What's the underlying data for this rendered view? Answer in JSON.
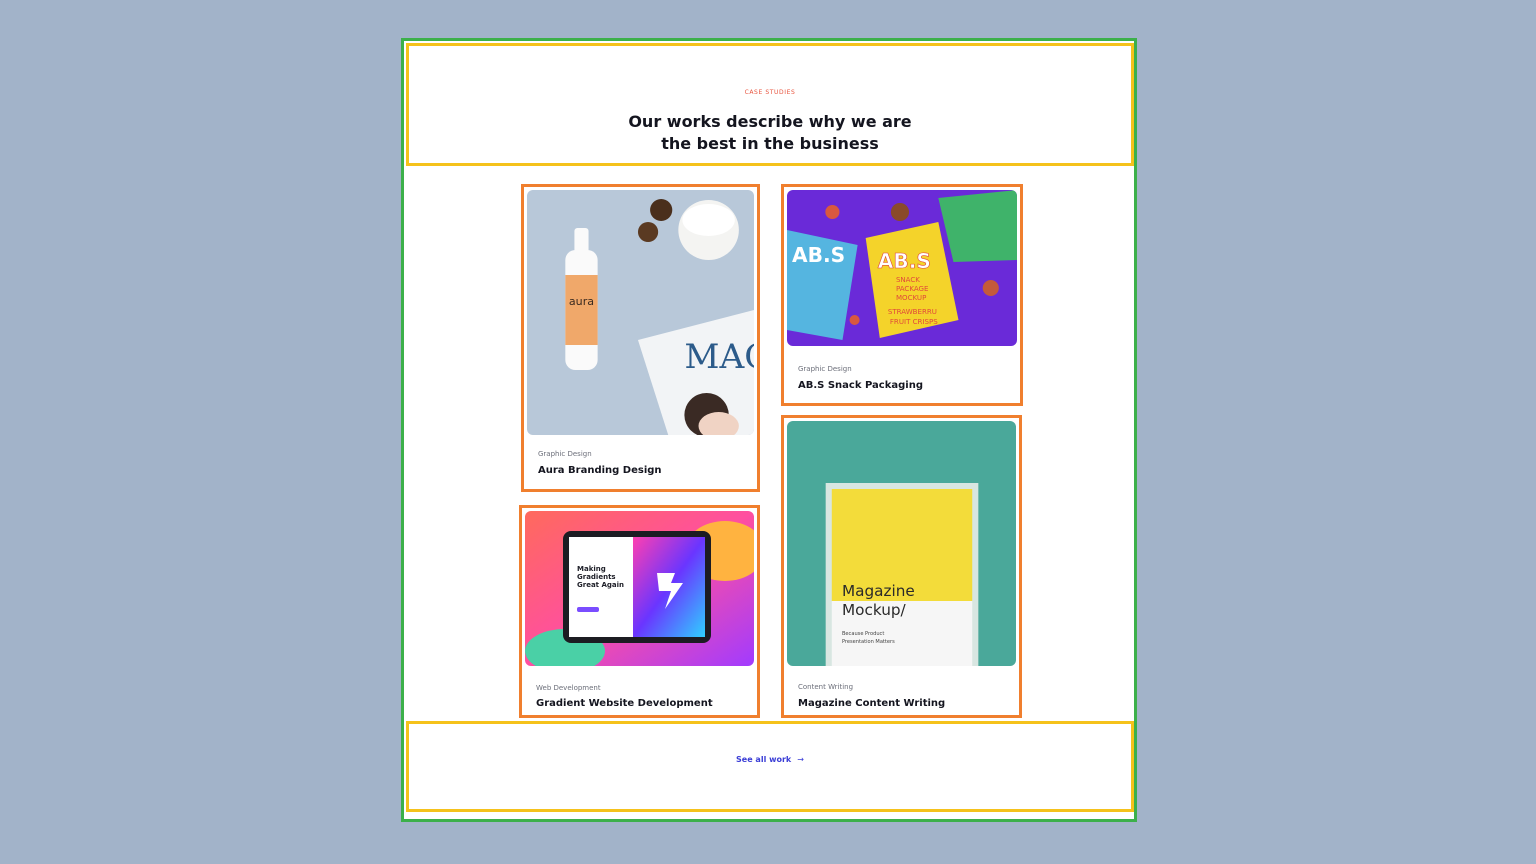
{
  "section": {
    "eyebrow": "CASE STUDIES",
    "headline_line1": "Our works describe why we are",
    "headline_line2": "the best in the business"
  },
  "cards": [
    {
      "category": "Graphic Design",
      "title": "Aura Branding Design",
      "image": "aura-spray-bottle-mockup"
    },
    {
      "category": "Graphic Design",
      "title": "AB.S Snack Packaging",
      "image": "snack-package-mockup"
    },
    {
      "category": "Web Development",
      "title": "Gradient Website Development",
      "image": "gradient-tablet-mockup"
    },
    {
      "category": "Content Writing",
      "title": "Magazine Content Writing",
      "image": "magazine-mockup"
    }
  ],
  "image_text": {
    "aura_brand": "aura",
    "mag_letters": "MAG",
    "abs_logo": "AB.S",
    "abs_line1": "SNACK",
    "abs_line2": "PACKAGE",
    "abs_line3": "MOCKUP",
    "abs_flavor1": "STRAWBERRU",
    "abs_flavor2": "FRUIT CRISPS",
    "gradient_heading1": "Making",
    "gradient_heading2": "Gradients",
    "gradient_heading3": "Great Again",
    "mag_heading1": "Magazine",
    "mag_heading2": "Mockup/",
    "mag_sub1": "Because Product",
    "mag_sub2": "Presentation Matters"
  },
  "footer": {
    "see_all_label": "See all work",
    "arrow": "→"
  },
  "colors": {
    "background": "#a2b3c9",
    "accent": "#e8543e",
    "link": "#3a3dd6",
    "green_outline": "#3cb04a",
    "yellow_outline": "#f5c21b",
    "orange_outline": "#f07f2e"
  }
}
